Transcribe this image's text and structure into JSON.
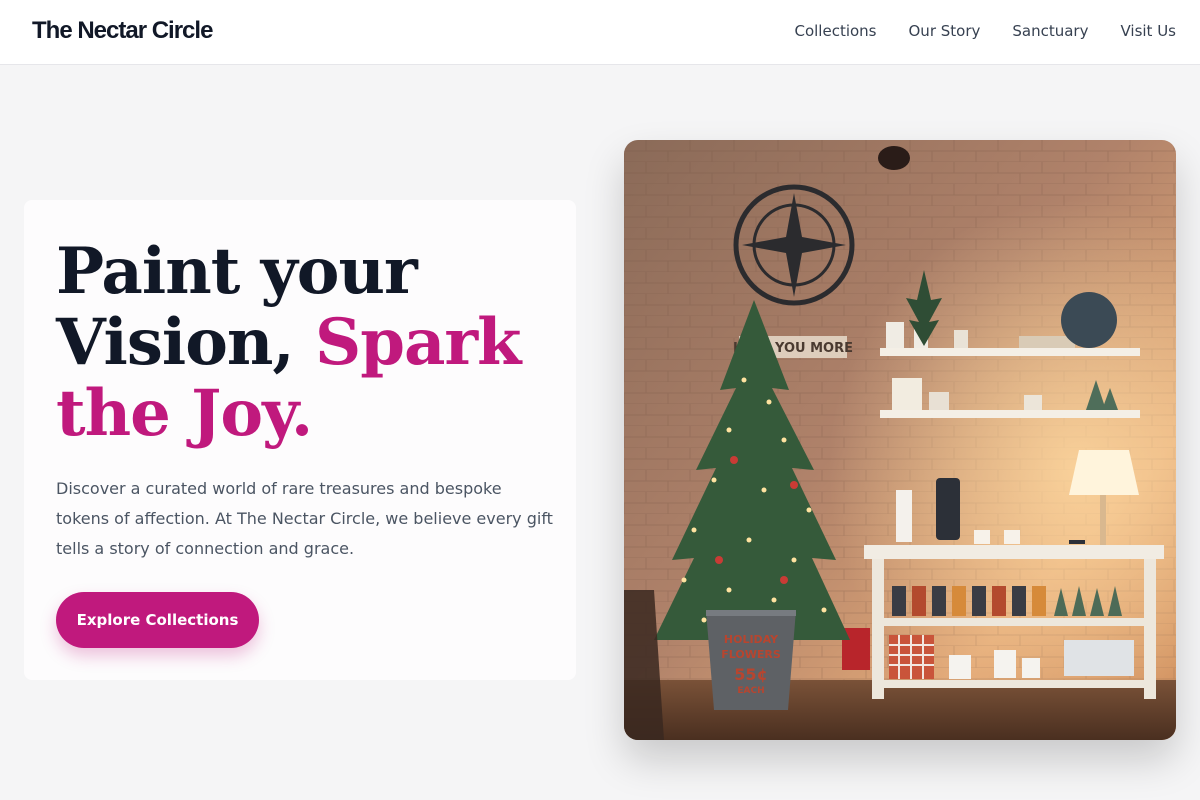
{
  "brand": {
    "name": "The Nectar Circle"
  },
  "nav": {
    "items": [
      {
        "label": "Collections"
      },
      {
        "label": "Our Story"
      },
      {
        "label": "Sanctuary"
      },
      {
        "label": "Visit Us"
      }
    ]
  },
  "hero": {
    "headline_line1": "Paint your",
    "headline_line2a": "Vision, ",
    "headline_line2b": "Spark",
    "headline_line3": "the Joy.",
    "description": "Discover a curated world of rare treasures and bespoke tokens of affection. At The Nectar Circle, we believe every gift tells a story of connection and grace.",
    "cta_label": "Explore Collections"
  },
  "photo": {
    "sign_text": "LOVE YOU MORE",
    "bucket_text_1": "HOLIDAY",
    "bucket_text_2": "FLOWERS",
    "bucket_price": "55¢",
    "bucket_unit": "EACH"
  },
  "colors": {
    "accent": "#c0197d",
    "ink": "#111827",
    "muted": "#4b5563",
    "page_bg": "#f5f5f6"
  }
}
